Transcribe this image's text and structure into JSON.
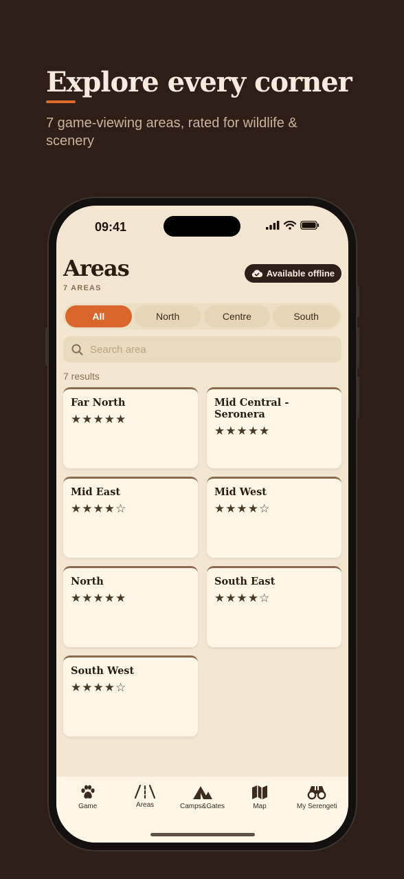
{
  "hero": {
    "title": "Explore every corner",
    "subtitle": "7 game-viewing areas, rated for wildlife & scenery"
  },
  "status_bar": {
    "time": "09:41"
  },
  "header": {
    "title": "Areas",
    "count": "7 AREAS",
    "offline_label": "Available offline"
  },
  "filters": [
    {
      "label": "All",
      "active": true
    },
    {
      "label": "North",
      "active": false
    },
    {
      "label": "Centre",
      "active": false
    },
    {
      "label": "South",
      "active": false
    }
  ],
  "search": {
    "placeholder": "Search area",
    "value": ""
  },
  "results_label": "7 results",
  "areas": [
    {
      "name": "Far North",
      "rating": 5,
      "stars": "★★★★★"
    },
    {
      "name": "Mid Central - Seronera",
      "rating": 5,
      "stars": "★★★★★"
    },
    {
      "name": "Mid East",
      "rating": 4,
      "stars": "★★★★☆"
    },
    {
      "name": "Mid West",
      "rating": 4,
      "stars": "★★★★☆"
    },
    {
      "name": "North",
      "rating": 5,
      "stars": "★★★★★"
    },
    {
      "name": "South East",
      "rating": 4,
      "stars": "★★★★☆"
    },
    {
      "name": "South West",
      "rating": 4,
      "stars": "★★★★☆"
    }
  ],
  "tabs": [
    {
      "label": "Game",
      "icon": "paw-icon"
    },
    {
      "label": "Areas",
      "icon": "road-icon"
    },
    {
      "label": "Camps&Gates",
      "icon": "tent-icon"
    },
    {
      "label": "Map",
      "icon": "map-icon"
    },
    {
      "label": "My Serengeti",
      "icon": "binoculars-icon"
    }
  ],
  "colors": {
    "background": "#2d1f17",
    "accent": "#d9652a",
    "screen": "#f2e6d1",
    "card": "#fdf6e7"
  }
}
